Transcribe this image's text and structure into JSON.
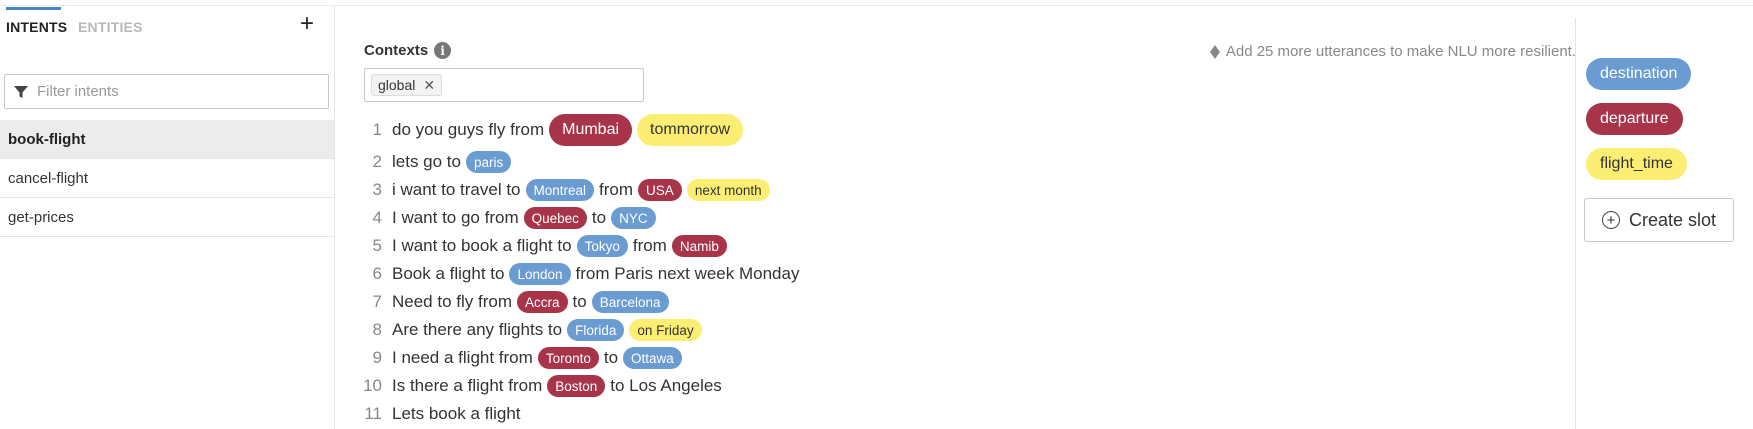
{
  "sidebar": {
    "tabs": [
      {
        "label": "INTENTS",
        "active": true
      },
      {
        "label": "ENTITIES",
        "active": false
      }
    ],
    "add_icon": "plus-icon",
    "filter": {
      "placeholder": "Filter intents",
      "value": ""
    },
    "intents": [
      {
        "label": "book-flight",
        "active": true
      },
      {
        "label": "cancel-flight",
        "active": false
      },
      {
        "label": "get-prices",
        "active": false
      }
    ]
  },
  "main": {
    "contexts_label": "Contexts",
    "info_icon": "info-icon",
    "hint": "Add 25 more utterances to make NLU more resilient.",
    "context_chip": "global",
    "utterances": [
      {
        "num": "1",
        "parts": [
          {
            "t": "do you guys fly from"
          },
          {
            "t": "Mumbai",
            "e": "departure"
          },
          {
            "t": "tommorrow",
            "e": "flight_time"
          }
        ]
      },
      {
        "num": "2",
        "parts": [
          {
            "t": "lets go to"
          },
          {
            "t": "paris",
            "e": "destination"
          }
        ]
      },
      {
        "num": "3",
        "parts": [
          {
            "t": "i want to travel to"
          },
          {
            "t": "Montreal",
            "e": "destination"
          },
          {
            "t": "from"
          },
          {
            "t": "USA",
            "e": "departure"
          },
          {
            "t": "next month",
            "e": "flight_time"
          }
        ]
      },
      {
        "num": "4",
        "parts": [
          {
            "t": "I want to go from"
          },
          {
            "t": "Quebec",
            "e": "departure"
          },
          {
            "t": "to"
          },
          {
            "t": "NYC",
            "e": "destination"
          }
        ]
      },
      {
        "num": "5",
        "parts": [
          {
            "t": "I want to book a flight to"
          },
          {
            "t": "Tokyo",
            "e": "destination"
          },
          {
            "t": "from"
          },
          {
            "t": "Namib",
            "e": "departure"
          }
        ]
      },
      {
        "num": "6",
        "parts": [
          {
            "t": "Book a flight to"
          },
          {
            "t": "London",
            "e": "destination"
          },
          {
            "t": "from Paris next week Monday"
          }
        ]
      },
      {
        "num": "7",
        "parts": [
          {
            "t": "Need to fly from"
          },
          {
            "t": "Accra",
            "e": "departure"
          },
          {
            "t": "to"
          },
          {
            "t": "Barcelona",
            "e": "destination"
          }
        ]
      },
      {
        "num": "8",
        "parts": [
          {
            "t": "Are there any flights to"
          },
          {
            "t": "Florida",
            "e": "destination"
          },
          {
            "t": "on Friday",
            "e": "flight_time"
          }
        ]
      },
      {
        "num": "9",
        "parts": [
          {
            "t": "I need a flight from"
          },
          {
            "t": "Toronto",
            "e": "departure"
          },
          {
            "t": "to"
          },
          {
            "t": "Ottawa",
            "e": "destination"
          }
        ]
      },
      {
        "num": "10",
        "parts": [
          {
            "t": "Is there a flight from"
          },
          {
            "t": "Boston",
            "e": "departure"
          },
          {
            "t": "to Los Angeles"
          }
        ]
      },
      {
        "num": "11",
        "parts": [
          {
            "t": "Lets book a flight"
          }
        ]
      }
    ]
  },
  "slots": {
    "items": [
      {
        "label": "destination",
        "color": "#6a9bd1"
      },
      {
        "label": "departure",
        "color": "#a8344a"
      },
      {
        "label": "flight_time",
        "color": "#fbee73"
      }
    ],
    "create_label": "Create slot"
  }
}
